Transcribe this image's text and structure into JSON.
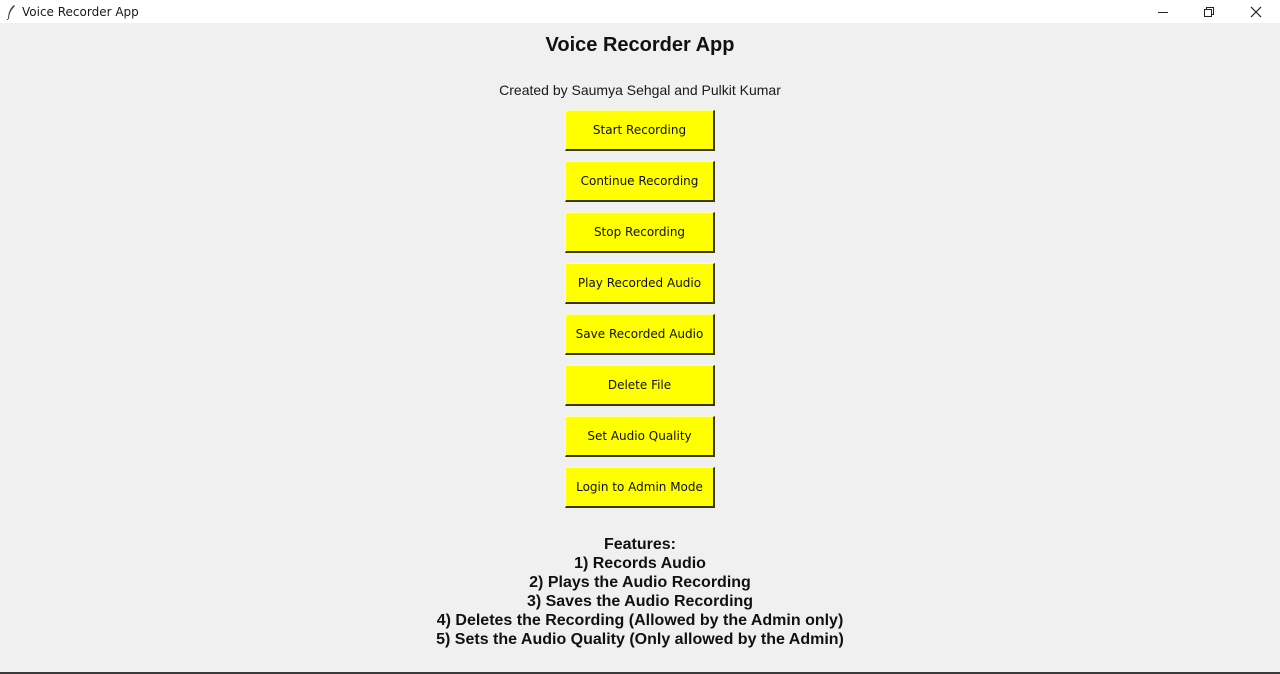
{
  "window": {
    "title": "Voice Recorder App"
  },
  "app": {
    "heading": "Voice Recorder App",
    "credit": "Created by Saumya Sehgal and Pulkit Kumar"
  },
  "buttons": [
    "Start Recording",
    "Continue Recording",
    "Stop Recording",
    "Play Recorded Audio",
    "Save Recorded Audio",
    "Delete File",
    "Set Audio Quality",
    "Login to Admin Mode"
  ],
  "features": {
    "title": "Features:",
    "items": [
      "1) Records Audio",
      "2) Plays the Audio Recording",
      "3) Saves the Audio Recording",
      "4) Deletes the Recording (Allowed by the Admin only)",
      "5) Sets the Audio Quality (Only allowed by the Admin)"
    ]
  },
  "colors": {
    "button_bg": "#ffff00",
    "window_bg": "#f0f0f0"
  }
}
